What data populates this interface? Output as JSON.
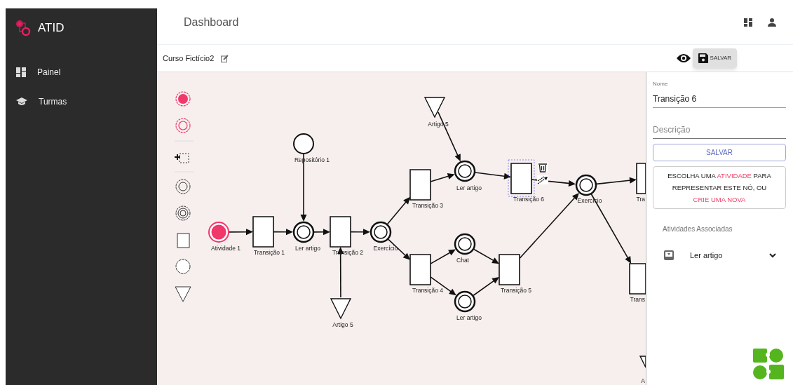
{
  "app": {
    "name": "ATID"
  },
  "sidebar": {
    "items": [
      {
        "label": "Painel"
      },
      {
        "label": "Turmas"
      }
    ]
  },
  "header": {
    "title": "Dashboard"
  },
  "toolbar": {
    "course": "Curso Fictício2",
    "save_button": "SALVAR"
  },
  "diagram": {
    "nodes": [
      {
        "kind": "start",
        "label": "Atividade 1",
        "selected": false
      },
      {
        "kind": "transition",
        "label": "Transição 1",
        "selected": false
      },
      {
        "kind": "resource",
        "label": "Repositório 1",
        "selected": false
      },
      {
        "kind": "place",
        "label": "Ler artigo",
        "selected": false
      },
      {
        "kind": "transition",
        "label": "Transição 2",
        "selected": false
      },
      {
        "kind": "content",
        "label": "Artigo 5",
        "selected": false
      },
      {
        "kind": "place",
        "label": "Exercício",
        "selected": false
      },
      {
        "kind": "content",
        "label": "Artigo 5",
        "selected": false
      },
      {
        "kind": "transition",
        "label": "Transição 3",
        "selected": false
      },
      {
        "kind": "transition",
        "label": "Transição 4",
        "selected": false
      },
      {
        "kind": "place",
        "label": "Ler artigo",
        "selected": false
      },
      {
        "kind": "place",
        "label": "Chat",
        "selected": false
      },
      {
        "kind": "place",
        "label": "Ler artigo",
        "selected": false
      },
      {
        "kind": "transition",
        "label": "Transição 6",
        "selected": true
      },
      {
        "kind": "transition",
        "label": "Transição 5",
        "selected": false
      },
      {
        "kind": "place",
        "label": "Exercício",
        "selected": false
      },
      {
        "kind": "transition",
        "label": "Tra",
        "selected": false
      },
      {
        "kind": "transition",
        "label": "Trans",
        "selected": false
      },
      {
        "kind": "content",
        "label": "A",
        "selected": false
      }
    ]
  },
  "panel": {
    "name_field": {
      "label": "Nome",
      "value": "Transição 6"
    },
    "description_field": {
      "placeholder": "Descrição"
    },
    "save_button": "SALVAR",
    "notice": [
      {
        "kind": "plain",
        "text": "ESCOLHA UMA "
      },
      {
        "kind": "link",
        "text": "ATIVIDADE"
      },
      {
        "kind": "plain",
        "text": " PARA REPRESENTAR ESTE NÓ, OU "
      },
      {
        "kind": "link",
        "text": "CRIE UMA NOVA"
      }
    ],
    "associated": {
      "title": "Atividades Associadas",
      "items": [
        {
          "label": "Ler artigo",
          "expanded": false
        }
      ]
    }
  }
}
